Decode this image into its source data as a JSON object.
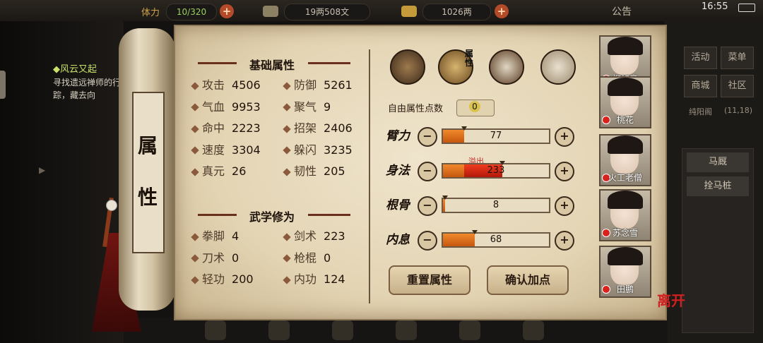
{
  "topbar": {
    "stamina_label": "体力",
    "stamina": "10/320",
    "money": "19两508文",
    "gold": "1026两",
    "announcement": "公告",
    "time": "16:55"
  },
  "quest": {
    "title": "风云又起",
    "desc": "寻找遗远禅师的行踪，藏去向"
  },
  "scroll_title": [
    "属",
    "性"
  ],
  "left": {
    "basic_header": "基础属性",
    "basic_stats": [
      {
        "name": "攻击",
        "value": "4506"
      },
      {
        "name": "防御",
        "value": "5261"
      },
      {
        "name": "气血",
        "value": "9953"
      },
      {
        "name": "聚气",
        "value": "9"
      },
      {
        "name": "命中",
        "value": "2223"
      },
      {
        "name": "招架",
        "value": "2406"
      },
      {
        "name": "速度",
        "value": "3304"
      },
      {
        "name": "躲闪",
        "value": "3235"
      },
      {
        "name": "真元",
        "value": "26"
      },
      {
        "name": "韧性",
        "value": "205"
      }
    ],
    "martial_header": "武学修为",
    "martial_stats": [
      {
        "name": "拳脚",
        "value": "4"
      },
      {
        "name": "剑术",
        "value": "223"
      },
      {
        "name": "刀术",
        "value": "0"
      },
      {
        "name": "枪棍",
        "value": "0"
      },
      {
        "name": "轻功",
        "value": "200"
      },
      {
        "name": "内功",
        "value": "124"
      }
    ]
  },
  "right": {
    "category_label": "属性",
    "free_points_label": "自由属性点数",
    "free_points": "0",
    "overflow_label": "溢出",
    "attributes": [
      {
        "name": "臂力",
        "value": "77",
        "fill": 0.2,
        "over": 0
      },
      {
        "name": "身法",
        "value": "233",
        "fill": 0.2,
        "over": 0.36
      },
      {
        "name": "根骨",
        "value": "8",
        "fill": 0.02,
        "over": 0
      },
      {
        "name": "内息",
        "value": "68",
        "fill": 0.3,
        "over": 0
      }
    ],
    "reset_button": "重置属性",
    "confirm_button": "确认加点"
  },
  "party": [
    {
      "name": "柳如意"
    },
    {
      "name": "桃花"
    },
    {
      "name": "火工老僧"
    },
    {
      "name": "苏念雪"
    },
    {
      "name": "田鹏"
    }
  ],
  "side": {
    "btn_activity": "活动",
    "btn_menu": "菜单",
    "btn_shop": "商城",
    "btn_community": "社区",
    "location": "纯阳阁",
    "coords": "(11,18)",
    "stable": "马厩",
    "tie_horse": "拴马桩"
  },
  "leave": "离开"
}
